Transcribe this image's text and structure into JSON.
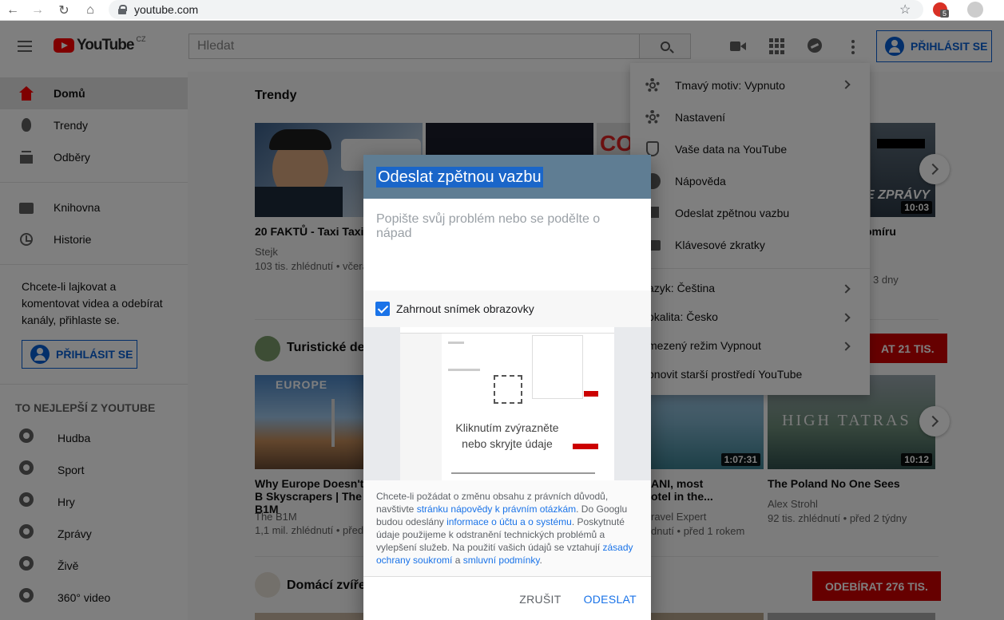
{
  "browser": {
    "url": "youtube.com",
    "ext_badge": "5"
  },
  "header": {
    "logo_text": "YouTube",
    "logo_country": "CZ",
    "search_placeholder": "Hledat",
    "signin_label": "PŘIHLÁSIT SE"
  },
  "sidebar": {
    "primary": [
      {
        "label": "Domů"
      },
      {
        "label": "Trendy"
      },
      {
        "label": "Odběry"
      }
    ],
    "library": [
      {
        "label": "Knihovna"
      },
      {
        "label": "Historie"
      }
    ],
    "signin_prompt": "Chcete-li lajkovat a komentovat videa a odebírat kanály, přihlaste se.",
    "signin_label": "PŘIHLÁSIT SE",
    "best_heading": "TO NEJLEPŠÍ Z YOUTUBE",
    "best": [
      {
        "label": "Hudba"
      },
      {
        "label": "Sport"
      },
      {
        "label": "Hry"
      },
      {
        "label": "Zprávy"
      },
      {
        "label": "Živě"
      },
      {
        "label": "360° video"
      }
    ]
  },
  "main": {
    "trending_title": "Trendy",
    "trending_videos": [
      {
        "title": "20 FAKTŮ - Taxi Taxi",
        "channel": "Stejk",
        "meta": "103 tis. zhlédnutí • včera"
      },
      {
        "title": "omíru",
        "channel": "",
        "meta": "3 dny",
        "duration": "10:03"
      }
    ],
    "section2_title": "Turistické des",
    "section2_subscribe": "AT  21 TIS.",
    "section2_videos": [
      {
        "title": "Why Europe Doesn't B Skyscrapers | The B1M",
        "channel": "The B1M",
        "meta": "1,1 mil. zhlédnutí • před"
      },
      {
        "title": "ANI, most otel in the...",
        "channel": "ravel Expert",
        "meta": "dnutí • před 1 rokem",
        "duration": "1:07:31"
      },
      {
        "title": "The Poland No One Sees",
        "channel": "Alex Strohl",
        "meta": "92 tis. zhlédnutí • před 2 týdny",
        "duration": "10:12"
      }
    ],
    "section3_title": "Domácí zvíře",
    "section3_subscribe": "ODEBÍRAT  276 TIS."
  },
  "thumb_text": {
    "europe": "EUROPE",
    "tatras": "HIGH TATRAS",
    "zpravy": "E ZPRÁVY",
    "co": "CO"
  },
  "menu": {
    "items": [
      {
        "label": "Tmavý motiv: Vypnuto"
      },
      {
        "label": "Nastavení"
      },
      {
        "label": "Vaše data na YouTube"
      },
      {
        "label": "Nápověda"
      },
      {
        "label": "Odeslat zpětnou vazbu"
      },
      {
        "label": "Klávesové zkratky"
      }
    ],
    "secondary": [
      {
        "label": "azyk: Čeština"
      },
      {
        "label": "okalita: Česko"
      },
      {
        "label": "mezený režim Vypnout"
      },
      {
        "label": "bnovit starší prostředí YouTube"
      }
    ]
  },
  "feedback": {
    "title": "Odeslat zpětnou vazbu",
    "placeholder": "Popište svůj problém nebo se podělte o nápad",
    "include_screenshot": "Zahrnout snímek obrazovky",
    "screenshot_hint": "Kliknutím zvýrazněte nebo skryjte údaje",
    "legal_1": "Chcete-li požádat o změnu obsahu z právních důvodů, navštivte ",
    "legal_link_1": "stránku nápovědy k právním otázkám",
    "legal_2": ". Do Googlu budou odeslány ",
    "legal_link_2": "informace o účtu a o systému",
    "legal_3": ". Poskytnuté údaje použijeme k odstranění technických problémů a vylepšení služeb. Na použití vašich údajů se vztahují ",
    "legal_link_3": "zásady ochrany soukromí",
    "legal_4": " a ",
    "legal_link_4": "smluvní podmínky",
    "legal_5": ".",
    "cancel_label": "ZRUŠIT",
    "send_label": "ODESLAT"
  },
  "colors": {
    "brand_red": "#ff0000",
    "link_blue": "#1a73e8",
    "dialog_header": "#5f7d93"
  }
}
